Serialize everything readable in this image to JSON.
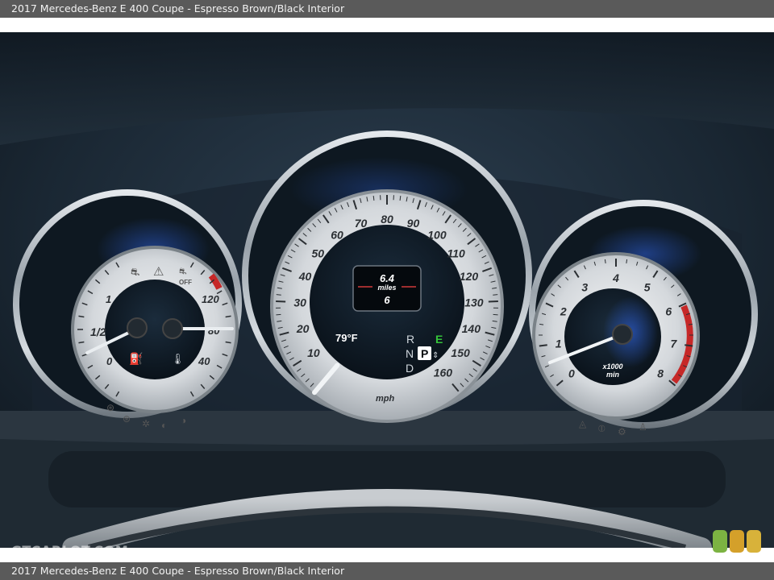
{
  "caption": {
    "top": "2017 Mercedes-Benz E 400 Coupe - Espresso Brown/Black Interior",
    "bottom": "2017 Mercedes-Benz E 400 Coupe - Espresso Brown/Black Interior"
  },
  "watermark": "GTCARLOT.COM",
  "badge_colors": [
    "#7cb342",
    "#d4a02a",
    "#d8b23a"
  ],
  "left_gauge": {
    "fuel_labels": [
      "0",
      "1/2",
      "1"
    ],
    "temp_labels": [
      "40",
      "80",
      "120"
    ]
  },
  "speedometer": {
    "labels": [
      "10",
      "20",
      "30",
      "40",
      "50",
      "60",
      "70",
      "80",
      "90",
      "100",
      "110",
      "120",
      "130",
      "140",
      "150",
      "160"
    ],
    "unit": "mph",
    "speed_value": 0
  },
  "center_display": {
    "trip": "6.4",
    "trip_unit": "miles",
    "odo": "6",
    "temperature": "79°F",
    "gear_r": "R",
    "gear_p": "P",
    "gear_n": "N",
    "gear_d": "D",
    "mode": "E"
  },
  "tachometer": {
    "labels": [
      "0",
      "1",
      "2",
      "3",
      "4",
      "5",
      "6",
      "7",
      "8"
    ],
    "unit_line1": "x1000",
    "unit_line2": "min",
    "rpm_value": 0
  }
}
